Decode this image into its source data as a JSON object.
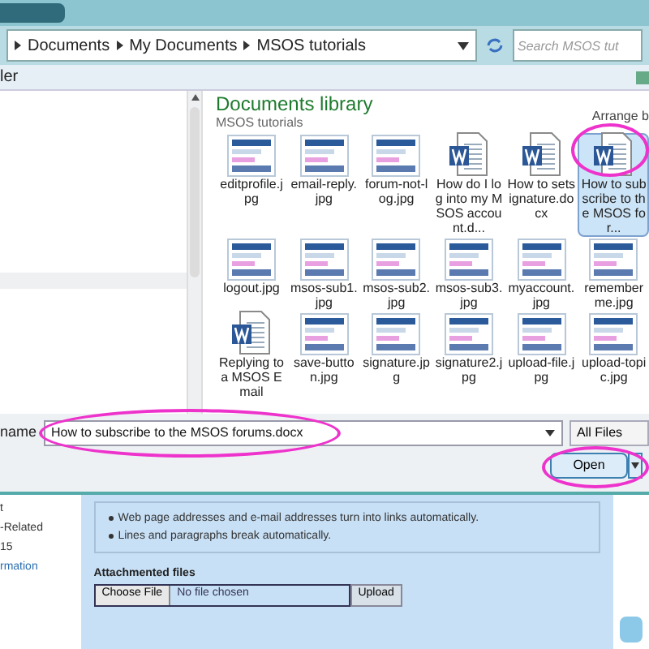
{
  "address_bar": {
    "breadcrumbs": [
      "Documents",
      "My Documents",
      "MSOS tutorials"
    ],
    "search": {
      "placeholder": "Search MSOS tut"
    }
  },
  "toolbar": {
    "label": "ler"
  },
  "library": {
    "title": "Documents library",
    "subtitle": "MSOS tutorials",
    "arrange": "Arrange b"
  },
  "files": [
    {
      "name": "editprofile.jpg",
      "kind": "image",
      "selected": false
    },
    {
      "name": "email-reply.jpg",
      "kind": "image",
      "selected": false
    },
    {
      "name": "forum-not-log.jpg",
      "kind": "image",
      "selected": false
    },
    {
      "name": "How do I log into my MSOS account.d...",
      "kind": "document",
      "selected": false
    },
    {
      "name": "How to setsignature.docx",
      "kind": "document",
      "selected": false
    },
    {
      "name": "How to subscribe to the MSOS for...",
      "kind": "document",
      "selected": true
    },
    {
      "name": "logout.jpg",
      "kind": "image",
      "selected": false
    },
    {
      "name": "msos-sub1.jpg",
      "kind": "image",
      "selected": false
    },
    {
      "name": "msos-sub2.jpg",
      "kind": "image",
      "selected": false
    },
    {
      "name": "msos-sub3.jpg",
      "kind": "image",
      "selected": false
    },
    {
      "name": "myaccount.jpg",
      "kind": "image",
      "selected": false
    },
    {
      "name": "rememberme.jpg",
      "kind": "image",
      "selected": false
    },
    {
      "name": "Replying to a MSOS Email",
      "kind": "document",
      "selected": false
    },
    {
      "name": "save-button.jpg",
      "kind": "image",
      "selected": false
    },
    {
      "name": "signature.jpg",
      "kind": "image",
      "selected": false
    },
    {
      "name": "signature2.jpg",
      "kind": "image",
      "selected": false
    },
    {
      "name": "upload-file.jpg",
      "kind": "image",
      "selected": false
    },
    {
      "name": "upload-topic.jpg",
      "kind": "image",
      "selected": false
    }
  ],
  "file_name": {
    "label": "name",
    "value": "How to subscribe to the MSOS forums.docx",
    "filter": "All Files"
  },
  "open_button": "Open",
  "web_page": {
    "sidebar": [
      {
        "text": "t",
        "kind": "text"
      },
      {
        "text": "-Related",
        "kind": "text"
      },
      {
        "text": "15",
        "kind": "text"
      },
      {
        "text": "rmation",
        "kind": "link"
      }
    ],
    "bullets": [
      "Web page addresses and e-mail addresses turn into links automatically.",
      "Lines and paragraphs break automatically."
    ],
    "attachments": {
      "title": "Attachmented files",
      "choose": "Choose File",
      "status": "No file chosen",
      "upload": "Upload"
    }
  }
}
